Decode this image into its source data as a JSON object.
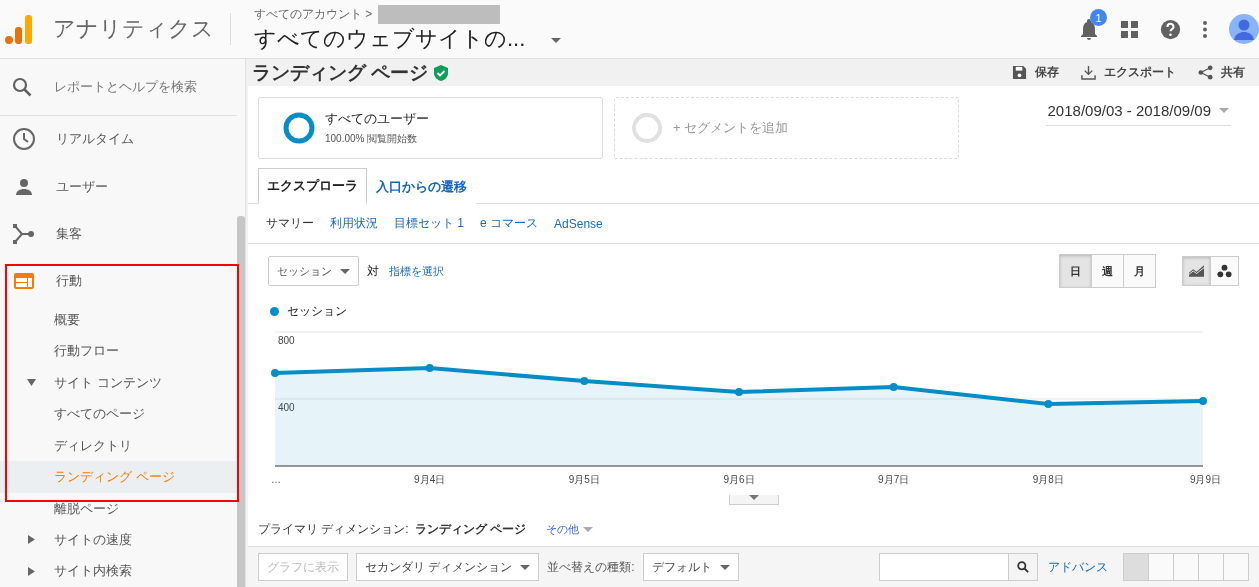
{
  "header": {
    "app_name": "アナリティクス",
    "breadcrumb": "すべてのアカウント >",
    "property_title": "すべてのウェブサイトの...",
    "notification_count": "1"
  },
  "sidebar": {
    "search_placeholder": "レポートとヘルプを検索",
    "items": [
      {
        "label": "リアルタイム",
        "selected": false
      },
      {
        "label": "ユーザー",
        "selected": false
      },
      {
        "label": "集客",
        "selected": false
      },
      {
        "label": "行動",
        "selected": false,
        "expanded": true,
        "children": [
          {
            "label": "概要",
            "selected": false
          },
          {
            "label": "行動フロー",
            "selected": false
          },
          {
            "label": "サイト コンテンツ",
            "selected": false,
            "expanded": true,
            "children": [
              {
                "label": "すべてのページ",
                "selected": false
              },
              {
                "label": "ディレクトリ",
                "selected": false
              },
              {
                "label": "ランディング ページ",
                "selected": true
              },
              {
                "label": "離脱ページ",
                "selected": false
              }
            ]
          },
          {
            "label": "サイトの速度",
            "selected": false,
            "expanded": false
          },
          {
            "label": "サイト内検索",
            "selected": false,
            "expanded": false
          }
        ]
      }
    ]
  },
  "report": {
    "title": "ランディング ページ",
    "actions": [
      "保存",
      "エクスポート",
      "共有"
    ]
  },
  "segments": [
    {
      "kind": "segment",
      "name": "すべてのユーザー",
      "subtitle": "100.00% 閲覧開始数"
    },
    {
      "kind": "add",
      "name": "+ セグメントを追加"
    }
  ],
  "date_range": "2018/09/03 - 2018/09/09",
  "tabs": [
    {
      "label": "エクスプローラ",
      "selected": true
    },
    {
      "label": "入口からの遷移",
      "selected": false
    }
  ],
  "subtabs": [
    {
      "label": "サマリー",
      "selected": true
    },
    {
      "label": "利用状況",
      "selected": false
    },
    {
      "label": "目標セット 1",
      "selected": false
    },
    {
      "label": "e コマース",
      "selected": false
    },
    {
      "label": "AdSense",
      "selected": false
    }
  ],
  "metric": {
    "value": "セッション",
    "versus": "対",
    "select_link": "指標を選択"
  },
  "periods": [
    {
      "label": "日",
      "selected": true
    },
    {
      "label": "週",
      "selected": false
    },
    {
      "label": "月",
      "selected": false
    }
  ],
  "chart_types": [
    {
      "kind": "line",
      "selected": true
    },
    {
      "kind": "motion",
      "selected": false
    }
  ],
  "chart_data": {
    "type": "area",
    "categories": [
      "…",
      "9月4日",
      "9月5日",
      "9月6日",
      "9月7日",
      "9月8日",
      "9月9日"
    ],
    "series": [
      {
        "name": "セッション",
        "color": "#058dc7",
        "values": [
          555,
          585,
          507,
          442,
          472,
          370,
          388
        ]
      }
    ],
    "ylim": [
      0,
      800
    ],
    "yticks": [
      400,
      800
    ]
  },
  "primary_dimension": {
    "label": "プライマリ ディメンション:",
    "value": "ランディング ページ",
    "other": "その他"
  },
  "table_toolbar": {
    "plot_button": "グラフに表示",
    "secondary_dimension": "セカンダリ ディメンション",
    "sort_label": "並べ替えの種類:",
    "sort_value": "デフォルト",
    "advanced": "アドバンス"
  }
}
